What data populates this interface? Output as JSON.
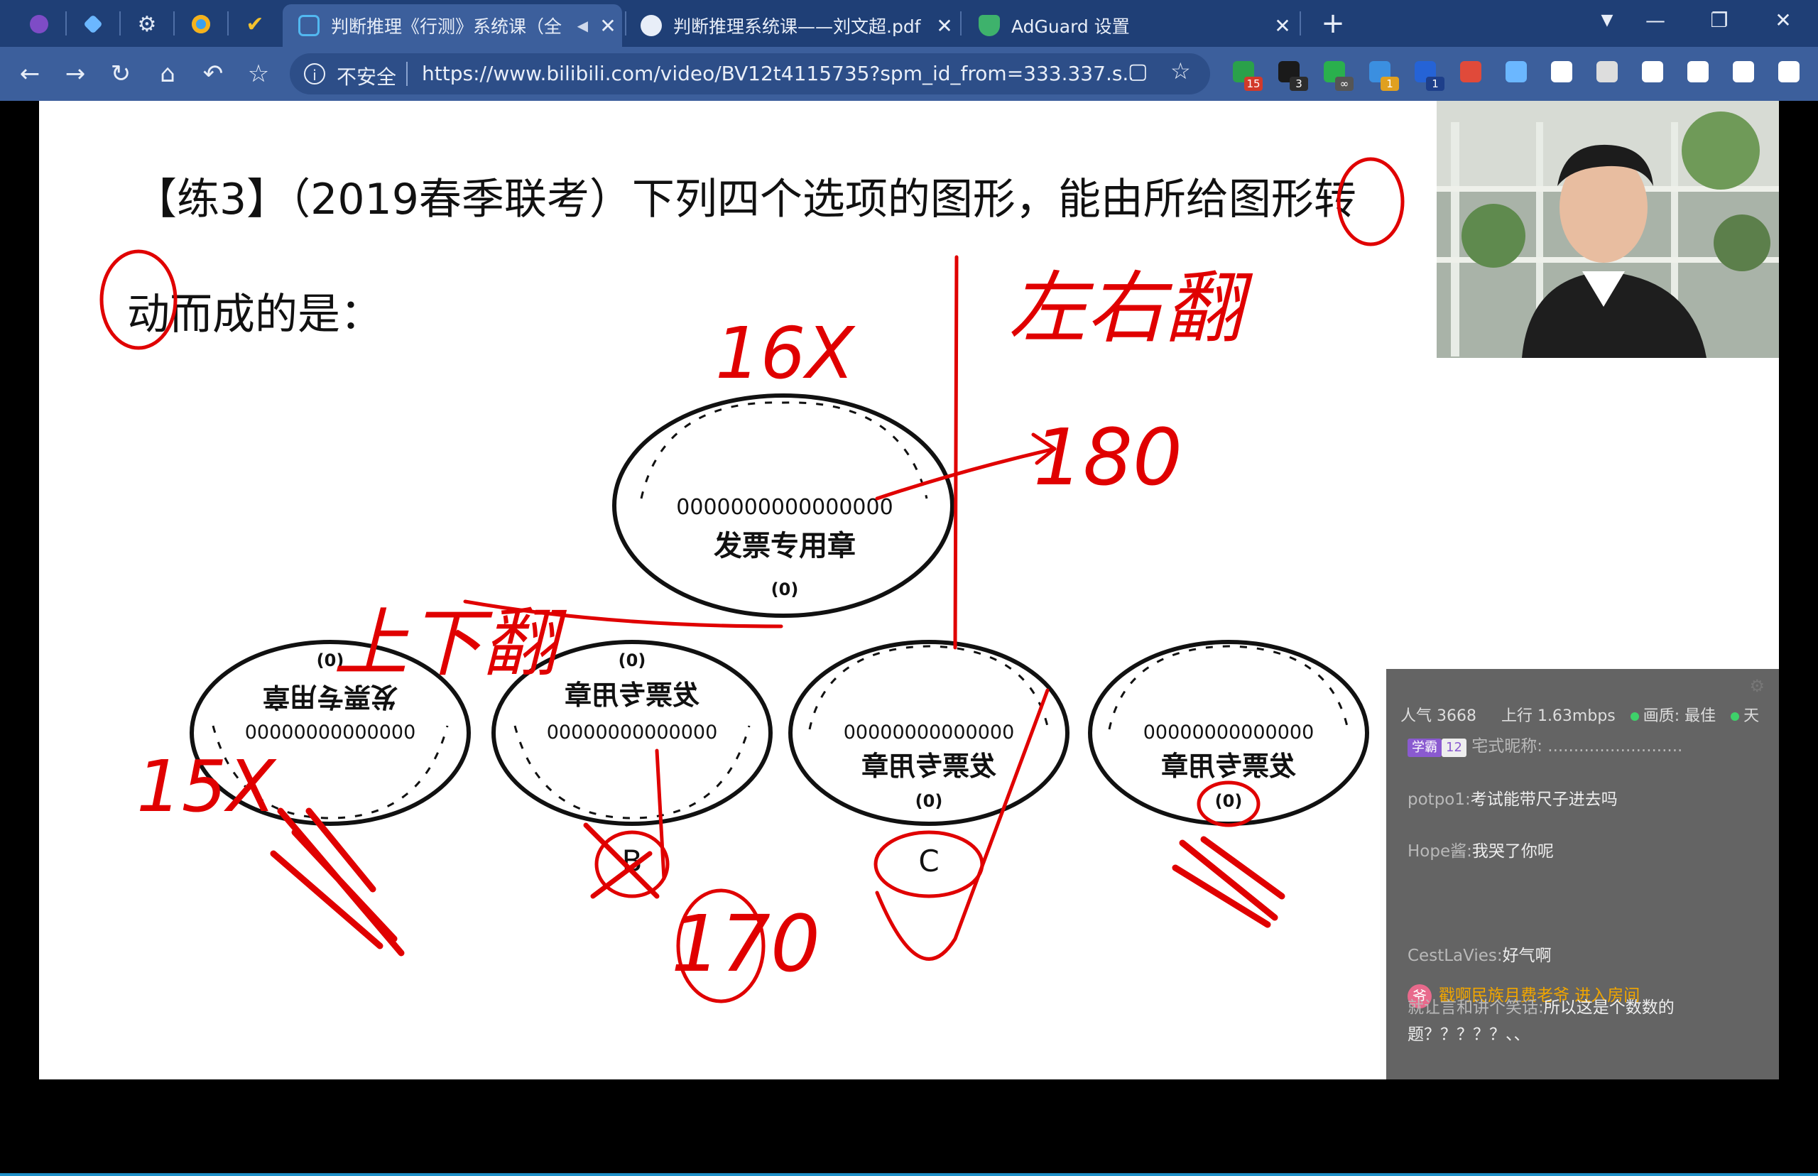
{
  "tabs": [
    {
      "title": "判断推理《行测》系统课（全",
      "active": true
    },
    {
      "title": "判断推理系统课——刘文超.pdf",
      "active": false
    },
    {
      "title": "AdGuard 设置",
      "active": false
    }
  ],
  "pinned_tabs": [
    "tor-browser-icon",
    "vpn-diamond-icon",
    "settings-gear-icon",
    "app-window-icon",
    "todo-check-icon"
  ],
  "window_controls": {
    "minimize": "—",
    "restore": "❐",
    "close": "✕"
  },
  "toolbar": {
    "insecure_label": "不安全",
    "url": "https://www.bilibili.com/video/BV12t4115735?spm_id_from=333.337.s...",
    "extensions": [
      {
        "name": "ext-grid-icon",
        "badge": "15",
        "color": "#2aa14a",
        "badge_color": "#d23a2a"
      },
      {
        "name": "ext-s-icon",
        "badge": "3",
        "color": "#1a1a1a",
        "badge_color": "#2c2c2c"
      },
      {
        "name": "ext-check-icon",
        "badge": "∞",
        "color": "#2ab04d",
        "badge_color": "#555555"
      },
      {
        "name": "ext-translate-icon",
        "badge": "1",
        "color": "#3b8fe0",
        "badge_color": "#e0a020"
      },
      {
        "name": "ext-u-icon",
        "badge": "1",
        "color": "#2563d6",
        "badge_color": "#1e3f8a"
      },
      {
        "name": "ext-note-icon",
        "badge": "",
        "color": "#e04a3a",
        "badge_color": ""
      },
      {
        "name": "ext-vpn-icon",
        "badge": "",
        "color": "#6bb7ff",
        "badge_color": ""
      },
      {
        "name": "ext-search-icon",
        "badge": "",
        "color": "#ffffff",
        "badge_color": ""
      },
      {
        "name": "ext-h-icon",
        "badge": "",
        "color": "#dddddd",
        "badge_color": ""
      },
      {
        "name": "ext-grid2-icon",
        "badge": "",
        "color": "#ffffff",
        "badge_color": ""
      },
      {
        "name": "playlist-icon",
        "badge": "",
        "color": "#ffffff",
        "badge_color": ""
      },
      {
        "name": "download-icon",
        "badge": "",
        "color": "#ffffff",
        "badge_color": ""
      },
      {
        "name": "menu-icon",
        "badge": "",
        "color": "#ffffff",
        "badge_color": ""
      }
    ]
  },
  "slide": {
    "question_line1": "【练3】（2019春季联考）下列四个选项的图形，能由所给图形转",
    "question_line2": "动而成的是：",
    "stamp_text": "发票专用章",
    "stamp_code": "(0)",
    "stamp_digits": "0000000000000000",
    "stamp_digits_short": "00000000000000",
    "option_b": "B",
    "option_c": "C",
    "annotations": {
      "count_top": "16X",
      "count_a": "15X",
      "flip_lr": "左右翻",
      "flip_ud": "上下翻",
      "rotate_top": "180",
      "rotate_b": "170"
    }
  },
  "chat": {
    "stats": {
      "popularity": "人气 3668",
      "upload": "上行 1.63mbps",
      "quality": "画质: 最佳",
      "extra": "天"
    },
    "level_badge": "学霸",
    "level_number": "12",
    "first_line": "宅式昵称: ..........................",
    "messages": [
      {
        "nick": "potpo1:",
        "text": "考试能带尺子进去吗"
      },
      {
        "nick": "Hope酱:",
        "text": "我哭了你呢"
      },
      {
        "nick": "CestLaVies:",
        "text": "好气啊"
      },
      {
        "nick": "就让言和讲个笑话:",
        "text": "所以这是个数数的题？？？？？、、"
      }
    ],
    "welcome": "戳啊民族月费老爷 进入房间",
    "welcome_icon": "爷"
  }
}
